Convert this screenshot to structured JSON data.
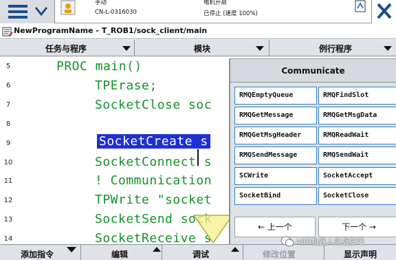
{
  "topbar": {
    "status_line1": "手动",
    "status_line2": "CN-L-0316030",
    "status_right1": "电机开启",
    "status_right2": "已停止 (速度 100%)"
  },
  "breadcrumb": {
    "text": "NewProgramName - T_ROB1/sock_client/main"
  },
  "tabs": [
    {
      "label": "任务与程序"
    },
    {
      "label": "模块"
    },
    {
      "label": "例行程序"
    }
  ],
  "editor": {
    "lines": [
      {
        "num": "5",
        "text": "PROC main()"
      },
      {
        "num": "6",
        "text": "TPErase;"
      },
      {
        "num": "7",
        "text": "SocketClose soc"
      },
      {
        "num": "8",
        "text": ""
      },
      {
        "num": "9",
        "text": "SocketCreate s"
      },
      {
        "num": "10",
        "text": "SocketConnect s"
      },
      {
        "num": "11",
        "text": "! Communication"
      },
      {
        "num": "12",
        "text": "TPWrite \"socket"
      },
      {
        "num": "13",
        "text": "SocketSend sock"
      },
      {
        "num": "14",
        "text": "SocketReceive s"
      }
    ]
  },
  "panel": {
    "title": "Communicate",
    "buttons": [
      "RMQEmptyQueue",
      "RMQFindSlot",
      "RMQGetMessage",
      "RMQGetMsgData",
      "RMQGetMsgHeader",
      "RMQReadWait",
      "RMQSendMessage",
      "RMQSendWait",
      "SCWrite",
      "SocketAccept",
      "SocketBind",
      "SocketClose"
    ],
    "prev_label": "←  上一个",
    "next_label": "下一个  →"
  },
  "bottombar": {
    "items": [
      "添加指令",
      "编辑",
      "调试",
      "修改位置",
      "显示声明"
    ]
  },
  "watermark": {
    "text": "ABB机器人实战技巧"
  },
  "colors": {
    "code_green": "#14912a",
    "selection_blue": "#1f2fd6",
    "button_border": "#2f7ec7"
  }
}
